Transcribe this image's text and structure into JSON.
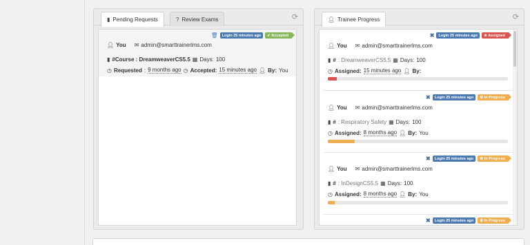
{
  "pending_panel": {
    "tabs": [
      {
        "icon": "book-icon",
        "label": "Pending Requests"
      },
      {
        "icon": "question-circle-icon",
        "label": "Review Exams"
      }
    ],
    "request": {
      "login_badge": "Login 25 minutes ago",
      "status_badge": "✔ Accepted",
      "user_name": "You",
      "email": "admin@smarttrainerlms.com",
      "course": "#Course : DreamweaverCS5.5",
      "days_label": "Days:",
      "days": "100",
      "requested_label": "Requested",
      "requested_value": "9 months ago",
      "accepted_label": "Accepted:",
      "accepted_value": "15 minutes ago",
      "by_label": "By:",
      "by_value": "You"
    }
  },
  "trainee_panel": {
    "tab": {
      "icon": "user-icon",
      "label": "Trainee Progress"
    },
    "items": [
      {
        "login_badge": "Login 25 minutes ago",
        "status_badge": "★ Assigned",
        "status_color": "#d9534f",
        "user_name": "You",
        "email": "admin@smarttrainerlms.com",
        "course_prefix": "#",
        "course_name": ": DreamweaverCS5.5",
        "days_label": "Days:",
        "days": "100",
        "assigned_label": "Assigned:",
        "assigned_value": "15 minutes ago",
        "by_label": "By:",
        "by_value": "",
        "progress": 0.05,
        "progress_color": "#d9534f"
      },
      {
        "login_badge": "Login 25 minutes ago",
        "status_badge": "⚙ In Progress",
        "status_color": "#f0ad4e",
        "user_name": "You",
        "email": "admin@smarttrainerlms.com",
        "course_prefix": "#",
        "course_name": ": Respiratory Safety",
        "days_label": "Days:",
        "days": "100",
        "assigned_label": "Assigned:",
        "assigned_value": "8 months ago",
        "by_label": "By:",
        "by_value": "You",
        "progress": 0.15,
        "progress_color": "#f0ad4e"
      },
      {
        "login_badge": "Login 25 minutes ago",
        "status_badge": "⚙ In Progress",
        "status_color": "#f0ad4e",
        "user_name": "You",
        "email": "admin@smarttrainerlms.com",
        "course_prefix": "#",
        "course_name": ": InDesignCS5.5",
        "days_label": "Days:",
        "days": "100",
        "assigned_label": "Assigned:",
        "assigned_value": "8 months ago",
        "by_label": "By:",
        "by_value": "You",
        "progress": 0.04,
        "progress_color": "#f0ad4e"
      },
      {
        "login_badge": "Login 25 minutes ago",
        "status_badge": "⚙ In Progress",
        "status_color": "#f0ad4e"
      }
    ]
  }
}
